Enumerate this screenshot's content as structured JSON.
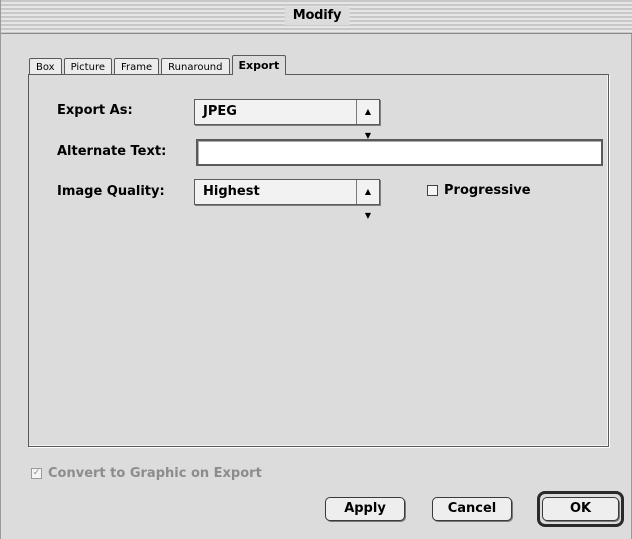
{
  "window": {
    "title": "Modify"
  },
  "tabs": [
    {
      "label": "Box",
      "active": false
    },
    {
      "label": "Picture",
      "active": false
    },
    {
      "label": "Frame",
      "active": false
    },
    {
      "label": "Runaround",
      "active": false
    },
    {
      "label": "Export",
      "active": true
    }
  ],
  "export": {
    "export_as_label": "Export As:",
    "export_as_value": "JPEG",
    "alt_text_label": "Alternate Text:",
    "alt_text_value": "",
    "quality_label": "Image Quality:",
    "quality_value": "Highest",
    "progressive_label": "Progressive",
    "progressive_checked": false
  },
  "footer": {
    "convert_label": "Convert to Graphic on Export",
    "convert_checked": true,
    "convert_disabled": true,
    "apply_label": "Apply",
    "cancel_label": "Cancel",
    "ok_label": "OK"
  },
  "icons": {
    "popup_arrow": "up-down-arrow-icon",
    "check": "checkmark-icon"
  }
}
